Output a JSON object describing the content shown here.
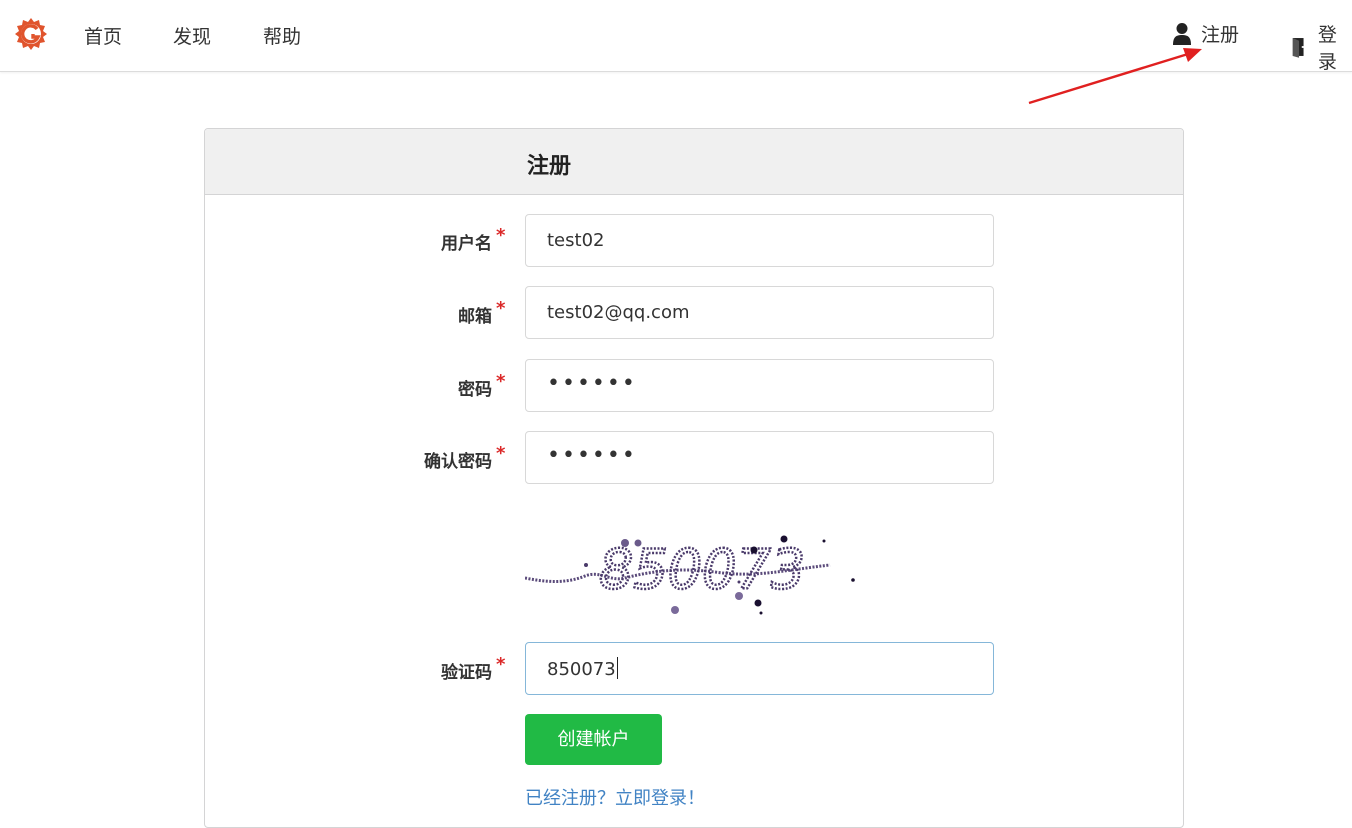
{
  "nav": {
    "home": "首页",
    "explore": "发现",
    "help": "帮助",
    "register": "注册",
    "login": "登录"
  },
  "form": {
    "title": "注册",
    "username_label": "用户名",
    "username_value": "test02",
    "email_label": "邮箱",
    "email_value": "test02@qq.com",
    "password_label": "密码",
    "password_value": "••••••",
    "confirm_label": "确认密码",
    "confirm_value": "••••••",
    "captcha_image_text": "850073",
    "captcha_label": "验证码",
    "captcha_value": "850073",
    "required_mark": "*",
    "submit": "创建帐户",
    "signin_prompt": "已经注册？立即登录！"
  },
  "colors": {
    "brand": "#e0542d",
    "primary_button": "#21ba45",
    "link": "#4183c4",
    "required": "#db2828",
    "annotation_arrow": "#e02020"
  }
}
